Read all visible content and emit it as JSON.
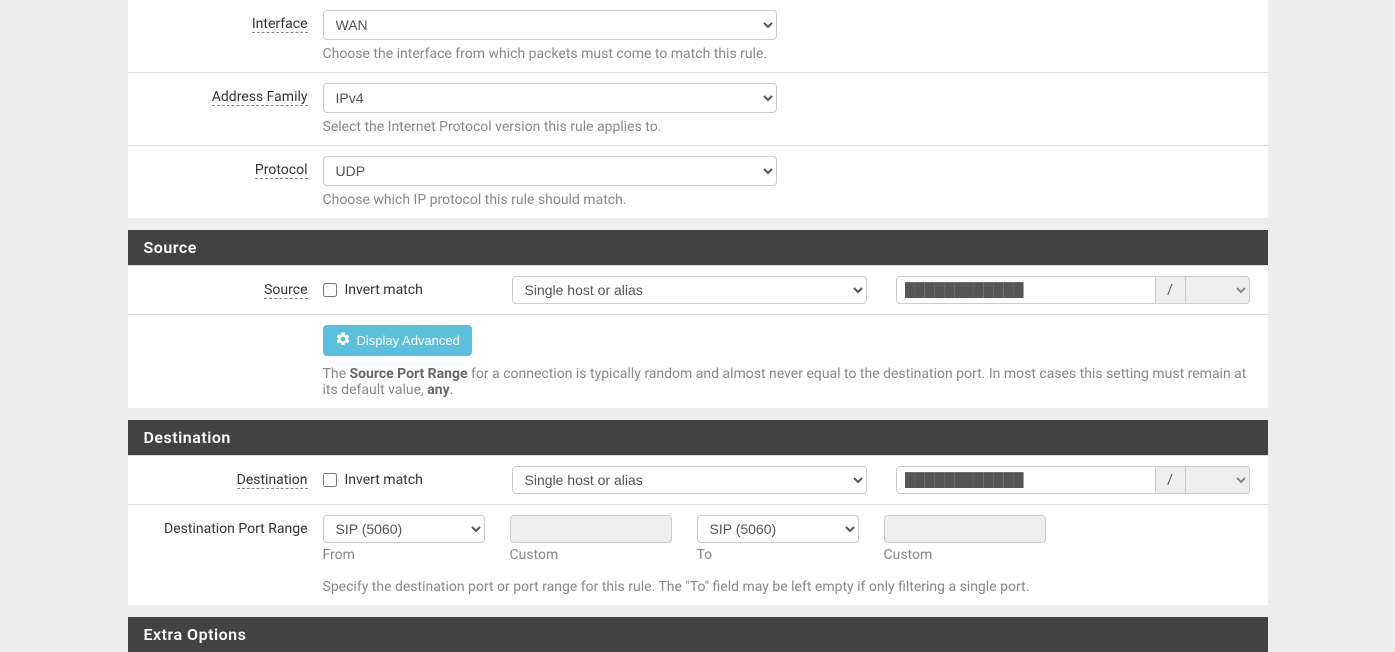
{
  "interface": {
    "label": "Interface",
    "value": "WAN",
    "help": "Choose the interface from which packets must come to match this rule."
  },
  "addressFamily": {
    "label": "Address Family",
    "value": "IPv4",
    "help": "Select the Internet Protocol version this rule applies to."
  },
  "protocol": {
    "label": "Protocol",
    "value": "UDP",
    "help": "Choose which IP protocol this rule should match."
  },
  "source": {
    "header": "Source",
    "label": "Source",
    "invertLabel": "Invert match",
    "typeValue": "Single host or alias",
    "addressValue": "████████████",
    "slash": "/",
    "maskValue": "",
    "advancedButton": "Display Advanced",
    "descPrefix": "The ",
    "descBold1": "Source Port Range",
    "descMiddle": " for a connection is typically random and almost never equal to the destination port. In most cases this setting must remain at its default value, ",
    "descBold2": "any",
    "descSuffix": "."
  },
  "destination": {
    "header": "Destination",
    "label": "Destination",
    "invertLabel": "Invert match",
    "typeValue": "Single host or alias",
    "addressValue": "████████████",
    "slash": "/",
    "maskValue": "",
    "portLabel": "Destination Port Range",
    "fromValue": "SIP (5060)",
    "fromSub": "From",
    "fromCustomSub": "Custom",
    "toValue": "SIP (5060)",
    "toSub": "To",
    "toCustomSub": "Custom",
    "portHelp": "Specify the destination port or port range for this rule. The \"To\" field may be left empty if only filtering a single port."
  },
  "extraOptions": {
    "header": "Extra Options"
  }
}
